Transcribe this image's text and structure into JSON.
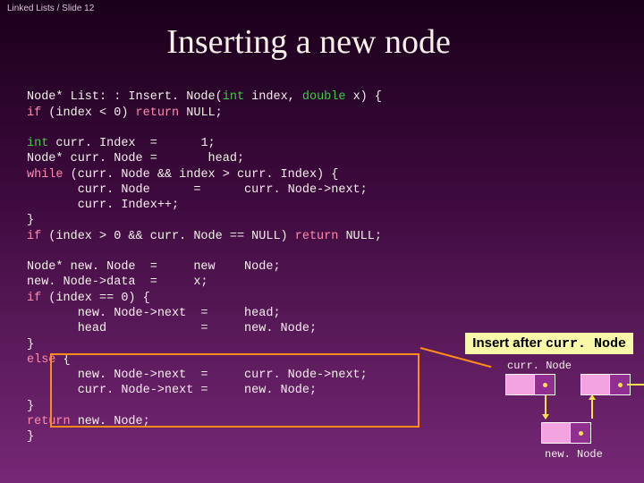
{
  "breadcrumb": "Linked Lists / Slide 12",
  "title": "Inserting a new node",
  "code": {
    "l1a": "Node* List: : Insert. Node(",
    "l1b": "int",
    "l1c": " index, ",
    "l1d": "double",
    "l1e": " x) {",
    "l2a": "if",
    "l2b": " (index < 0) ",
    "l2c": "return",
    "l2d": " NULL;",
    "l3a": "int",
    "l3b": " curr. Index  =      1;",
    "l4": "Node* curr. Node =       head;",
    "l5a": "while",
    "l5b": " (curr. Node && index > curr. Index) {",
    "l6": "       curr. Node      =      curr. Node->next;",
    "l7": "       curr. Index++;",
    "l8": "}",
    "l9a": "if",
    "l9b": " (index > 0 && curr. Node == NULL) ",
    "l9c": "return",
    "l9d": " NULL;",
    "l10": "Node* new. Node  =     new    Node;",
    "l11": "new. Node->data  =     x;",
    "l12a": "if",
    "l12b": " (index == 0) {",
    "l13": "       new. Node->next  =     head;",
    "l14": "       head             =     new. Node;",
    "l15": "}",
    "l16a": "else",
    "l16b": " {",
    "l17": "       new. Node->next  =     curr. Node->next;",
    "l18": "       curr. Node->next =     new. Node;",
    "l19": "}",
    "l20a": "return",
    "l20b": " new. Node;",
    "l21": "}"
  },
  "annotation": {
    "prefix": "Insert after ",
    "target": "curr. Node"
  },
  "diagram": {
    "label_curr": "curr. Node",
    "label_new": "new. Node"
  }
}
